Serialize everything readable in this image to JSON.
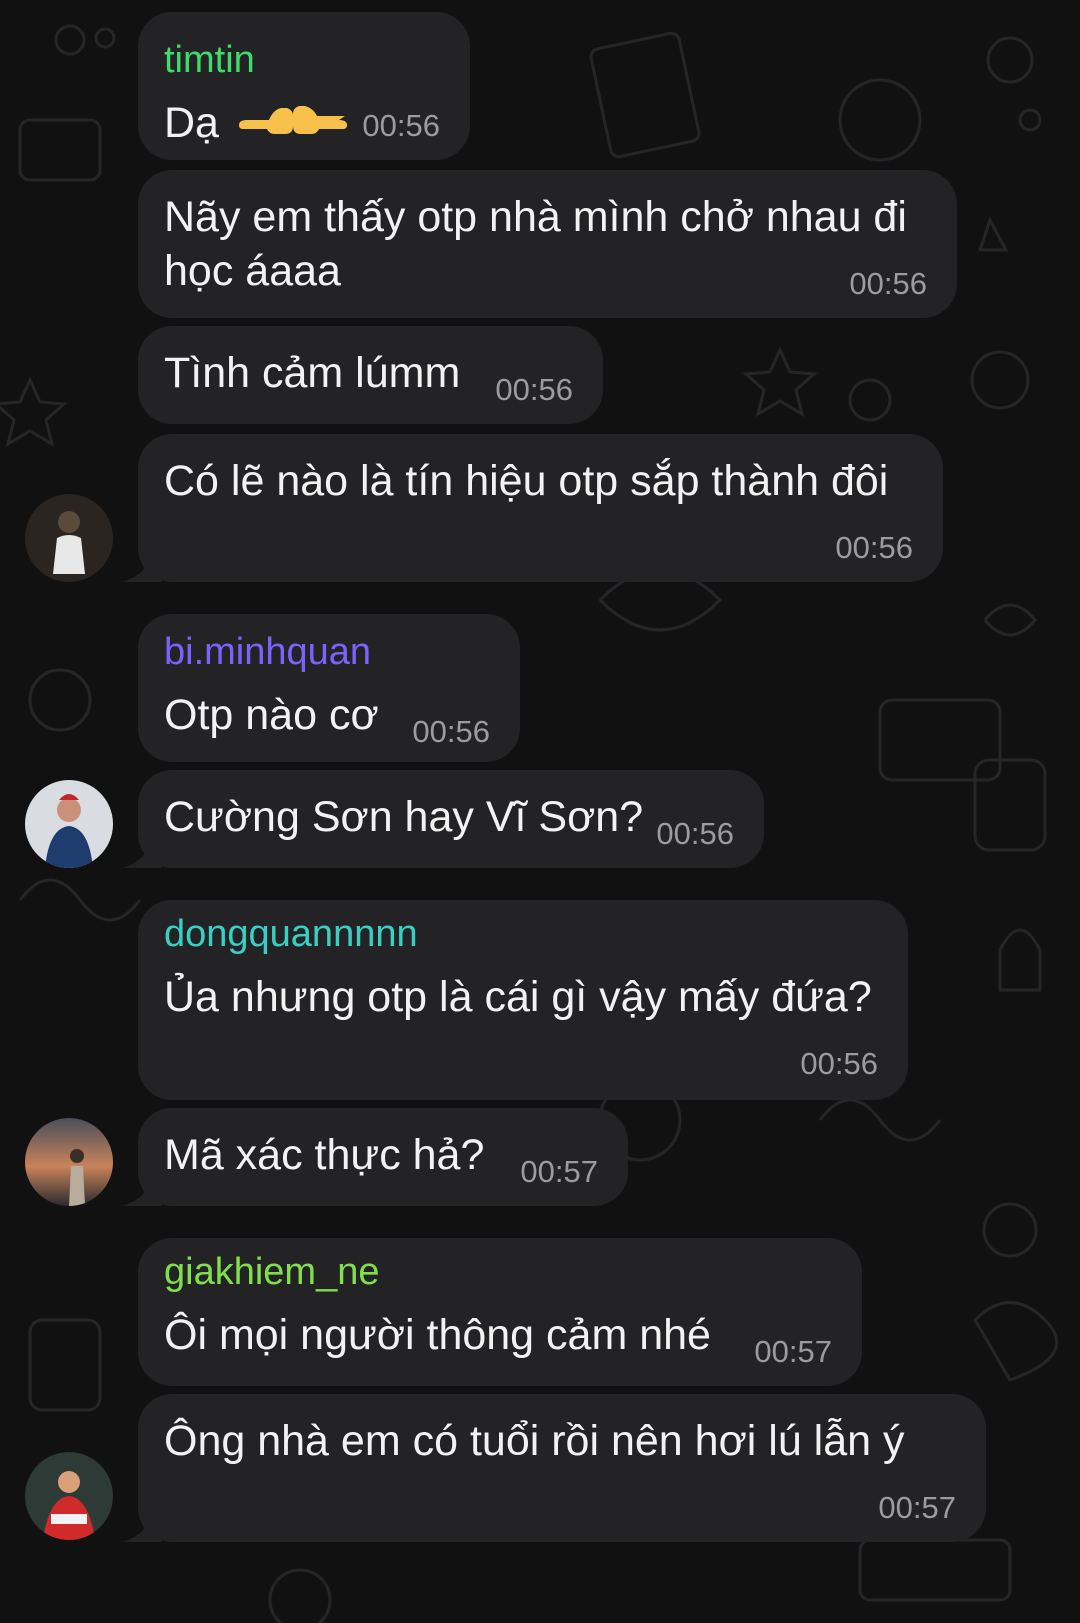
{
  "colors": {
    "background": "#111112",
    "bubble": "#232325",
    "text": "#f2f2f2",
    "time": "#9c9c9f",
    "sender_green": "#3ddc6b",
    "sender_purple": "#7b62ff",
    "sender_teal": "#39d0c4",
    "sender_lime": "#7fe04a"
  },
  "messages": [
    {
      "sender": "timtin",
      "text": "Dạ",
      "emoji": "backhand-index-pointing-left and right",
      "time": "00:56"
    },
    {
      "text": "Nãy em thấy otp nhà mình chở nhau đi học áaaa",
      "time": "00:56"
    },
    {
      "text": "Tình cảm lúmm",
      "time": "00:56"
    },
    {
      "text": "Có lẽ nào là tín hiệu otp sắp thành đôi",
      "time": "00:56"
    },
    {
      "sender": "bi.minhquan",
      "text": "Otp nào cơ",
      "time": "00:56"
    },
    {
      "text": "Cường Sơn hay Vĩ Sơn?",
      "time": "00:56"
    },
    {
      "sender": "dongquannnnn",
      "text": "Ủa nhưng otp là cái gì vậy mấy đứa?",
      "time": "00:56"
    },
    {
      "text": "Mã xác thực hả?",
      "time": "00:57"
    },
    {
      "sender": "giakhiem_ne",
      "text": "Ôi mọi người thông cảm nhé",
      "time": "00:57"
    },
    {
      "text": "Ông nhà em có tuổi rồi nên hơi lú lẫn ý",
      "time": "00:57"
    }
  ]
}
